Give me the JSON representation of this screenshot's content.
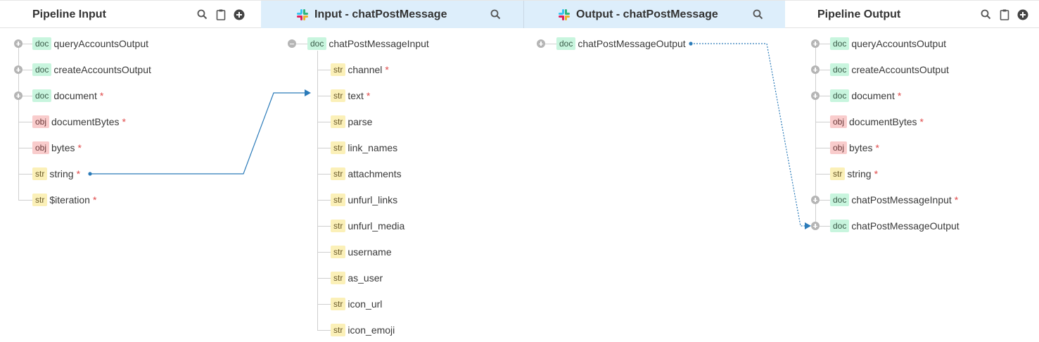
{
  "header": {
    "pipeline_input": {
      "title": "Pipeline Input"
    },
    "service_input": {
      "title": "Input - chatPostMessage"
    },
    "service_output": {
      "title": "Output - chatPostMessage"
    },
    "pipeline_output": {
      "title": "Pipeline Output"
    }
  },
  "pipeline_input": {
    "items": [
      {
        "type": "doc",
        "label": "queryAccountsOutput",
        "required": ""
      },
      {
        "type": "doc",
        "label": "createAccountsOutput",
        "required": ""
      },
      {
        "type": "doc",
        "label": "document",
        "required": "*"
      },
      {
        "type": "obj",
        "label": "documentBytes",
        "required": "*"
      },
      {
        "type": "obj",
        "label": "bytes",
        "required": "*"
      },
      {
        "type": "str",
        "label": "string",
        "required": "*"
      },
      {
        "type": "str",
        "label": "$iteration",
        "required": "*"
      }
    ]
  },
  "service_input": {
    "root": {
      "type": "doc",
      "label": "chatPostMessageInput"
    },
    "children": [
      {
        "type": "str",
        "label": "channel",
        "required": "*"
      },
      {
        "type": "str",
        "label": "text",
        "required": "*"
      },
      {
        "type": "str",
        "label": "parse",
        "required": ""
      },
      {
        "type": "str",
        "label": "link_names",
        "required": ""
      },
      {
        "type": "str",
        "label": "attachments",
        "required": ""
      },
      {
        "type": "str",
        "label": "unfurl_links",
        "required": ""
      },
      {
        "type": "str",
        "label": "unfurl_media",
        "required": ""
      },
      {
        "type": "str",
        "label": "username",
        "required": ""
      },
      {
        "type": "str",
        "label": "as_user",
        "required": ""
      },
      {
        "type": "str",
        "label": "icon_url",
        "required": ""
      },
      {
        "type": "str",
        "label": "icon_emoji",
        "required": ""
      }
    ]
  },
  "service_output": {
    "root": {
      "type": "doc",
      "label": "chatPostMessageOutput"
    }
  },
  "pipeline_output": {
    "items": [
      {
        "type": "doc",
        "label": "queryAccountsOutput",
        "required": ""
      },
      {
        "type": "doc",
        "label": "createAccountsOutput",
        "required": ""
      },
      {
        "type": "doc",
        "label": "document",
        "required": "*"
      },
      {
        "type": "obj",
        "label": "documentBytes",
        "required": "*"
      },
      {
        "type": "obj",
        "label": "bytes",
        "required": "*"
      },
      {
        "type": "str",
        "label": "string",
        "required": "*"
      },
      {
        "type": "doc",
        "label": "chatPostMessageInput",
        "required": "*"
      },
      {
        "type": "doc",
        "label": "chatPostMessageOutput",
        "required": ""
      }
    ]
  },
  "icons": {
    "search": "search-icon",
    "clipboard": "clipboard-icon",
    "add": "plus-circle-icon",
    "slack": "slack-logo-icon"
  },
  "colors": {
    "link_line": "#2b7bb9",
    "slack_header_bg": "#ddeefb",
    "required_mark": "#e04a4a"
  }
}
